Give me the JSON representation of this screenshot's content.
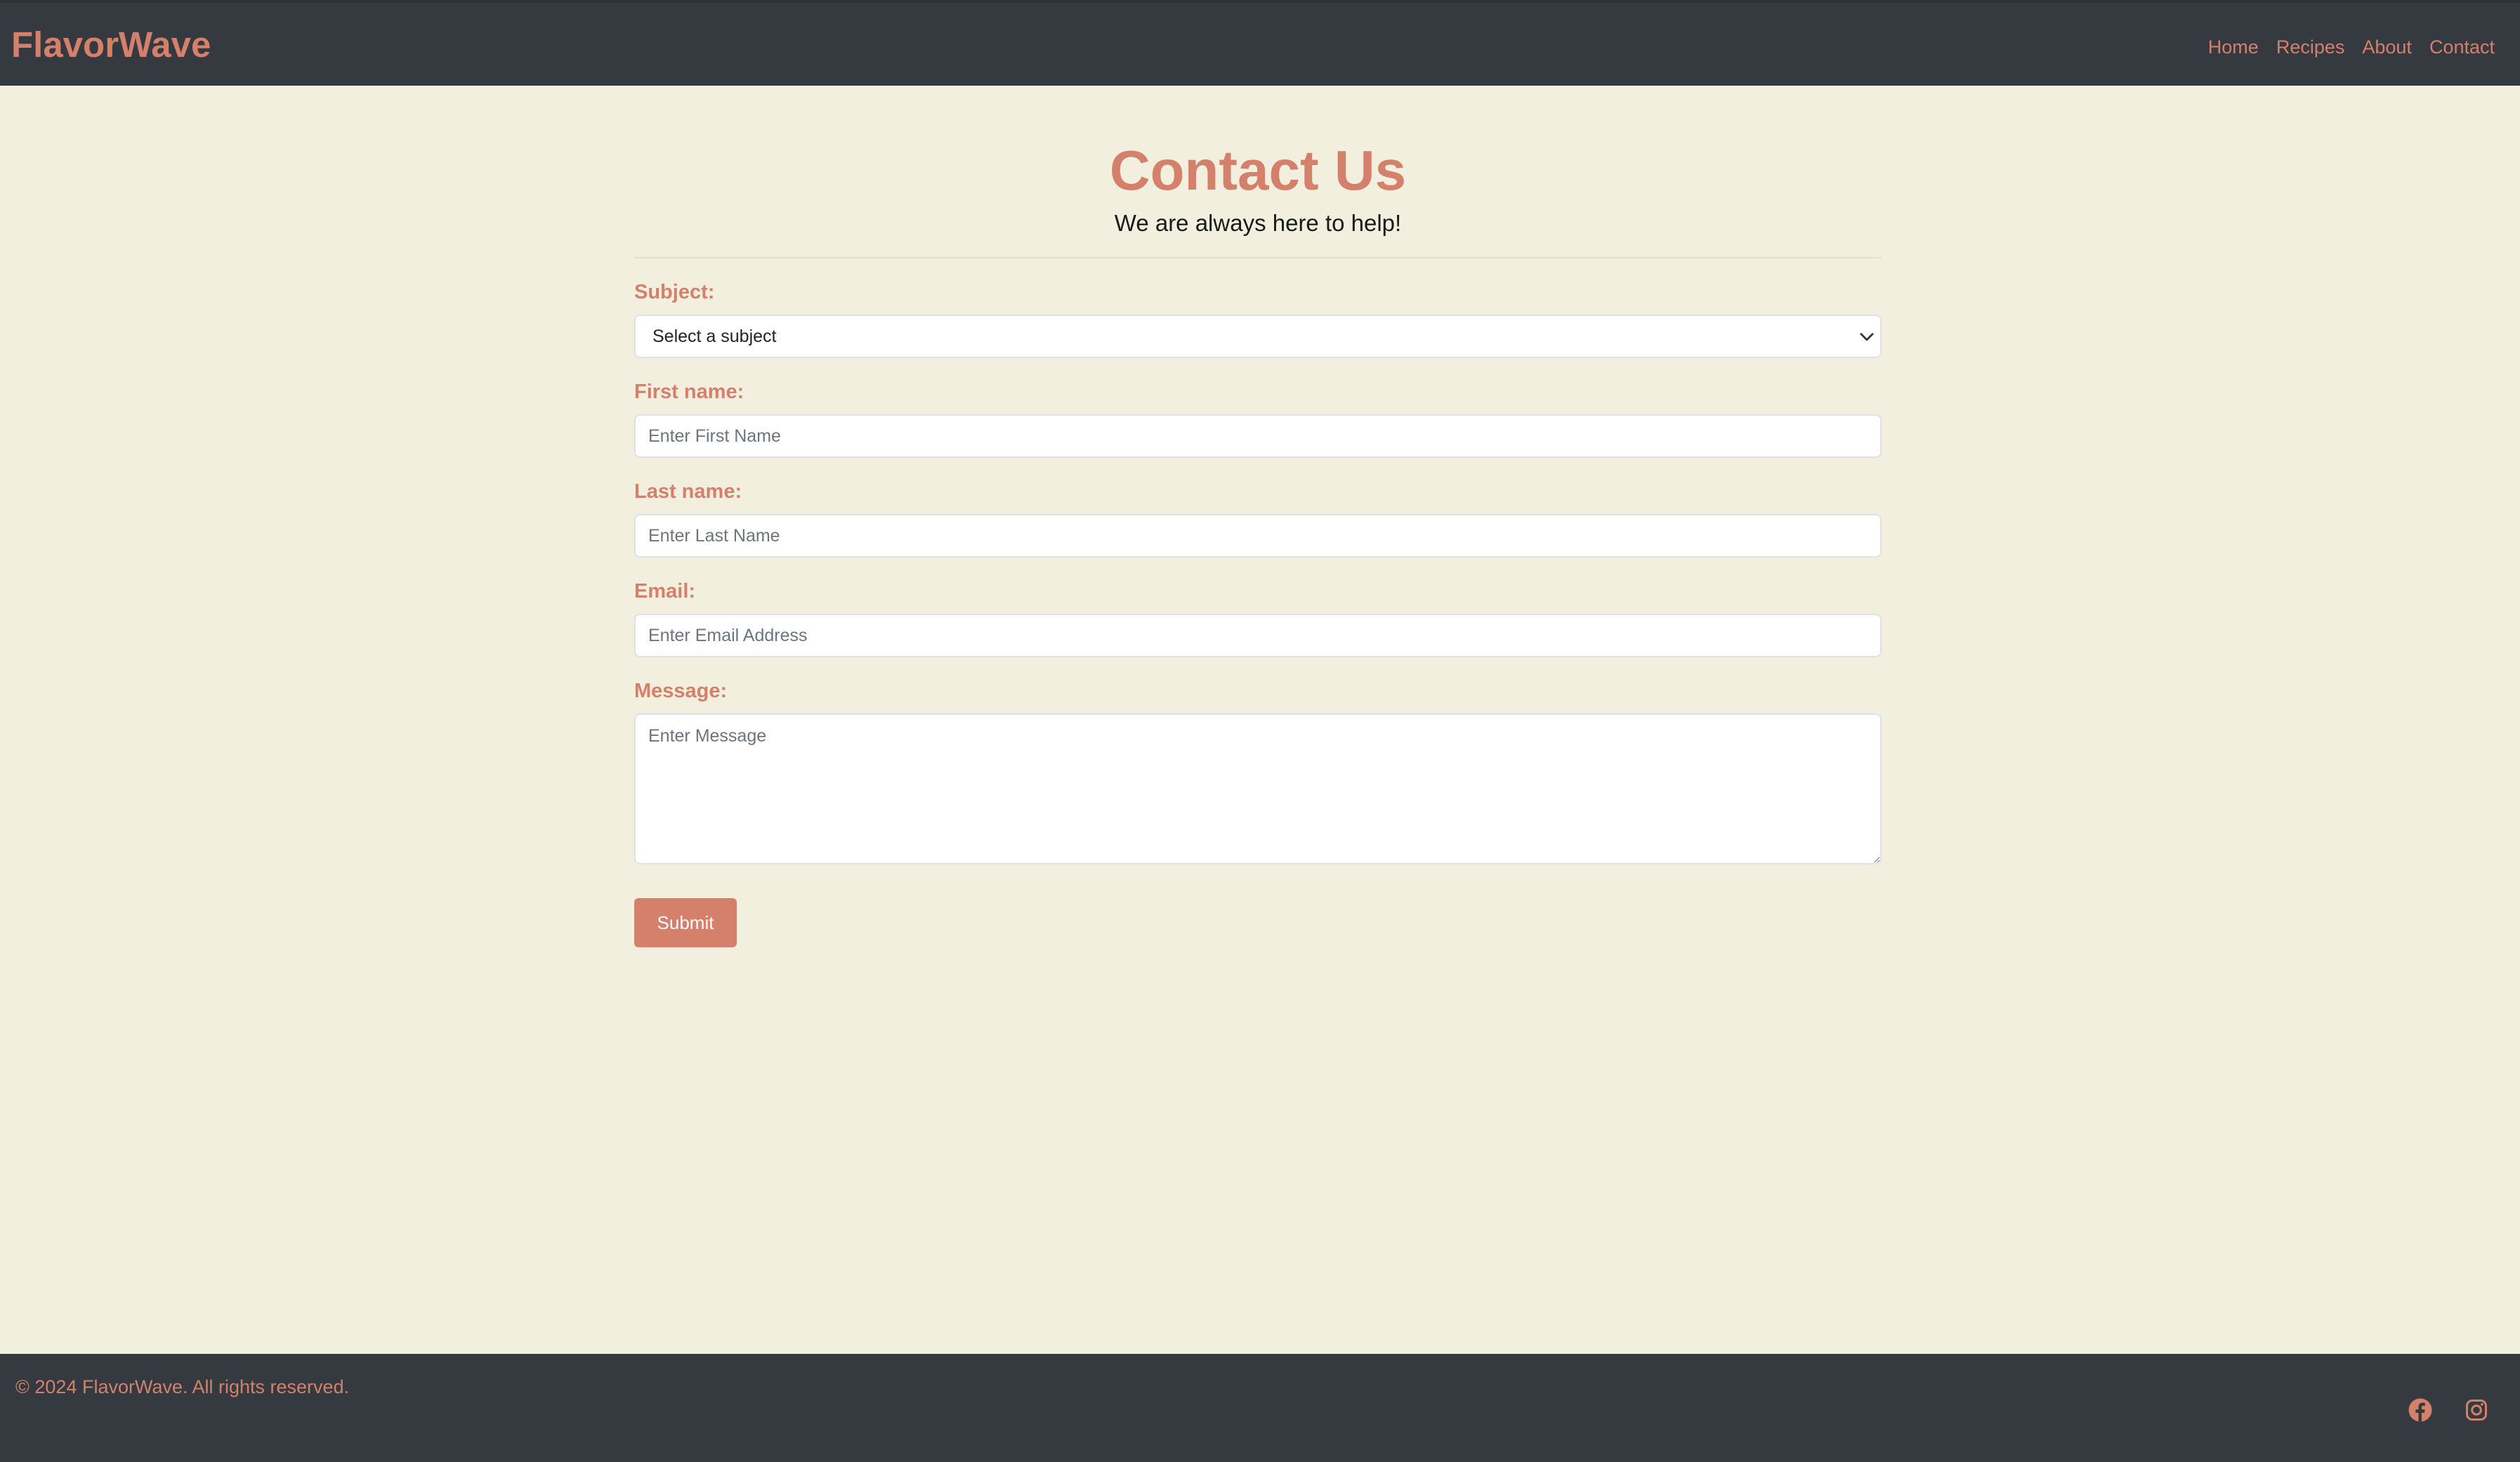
{
  "colors": {
    "accent": "#d4806a",
    "navbar_bg": "#343a40",
    "page_bg": "#f2efdf"
  },
  "header": {
    "brand": "FlavorWave",
    "nav": [
      {
        "label": "Home"
      },
      {
        "label": "Recipes"
      },
      {
        "label": "About"
      },
      {
        "label": "Contact"
      }
    ]
  },
  "main": {
    "title": "Contact Us",
    "subtitle": "We are always here to help!",
    "form": {
      "subject": {
        "label": "Subject:",
        "selected": "Select a subject"
      },
      "first_name": {
        "label": "First name:",
        "placeholder": "Enter First Name"
      },
      "last_name": {
        "label": "Last name:",
        "placeholder": "Enter Last Name"
      },
      "email": {
        "label": "Email:",
        "placeholder": "Enter Email Address"
      },
      "message": {
        "label": "Message:",
        "placeholder": "Enter Message"
      },
      "submit_label": "Submit"
    }
  },
  "footer": {
    "copyright": "© 2024 FlavorWave. All rights reserved.",
    "social": [
      {
        "icon": "facebook-icon"
      },
      {
        "icon": "instagram-icon"
      }
    ]
  }
}
